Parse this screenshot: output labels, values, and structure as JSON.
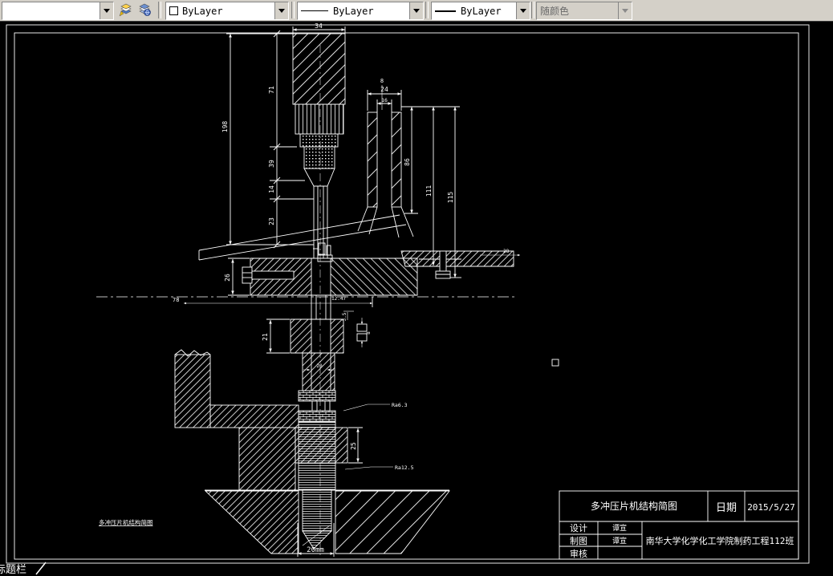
{
  "colors": {
    "toolbar_bg": "#d4d0c8",
    "canvas_bg": "#000000",
    "line": "#ffffff"
  },
  "toolbar": {
    "layer_combo_value": "",
    "color_value": "ByLayer",
    "linetype_value": "ByLayer",
    "lineweight_value": "ByLayer",
    "plotstyle_value": "随颜色"
  },
  "drawing": {
    "dims": {
      "d34": "34",
      "d71": "71",
      "d198": "198",
      "d39": "39",
      "d14": "14",
      "d23": "23",
      "d8top": "8",
      "d24": "24",
      "d16": "16",
      "d86": "86",
      "d111": "111",
      "d115": "115",
      "d26": "26",
      "d78": "78",
      "d28": "28",
      "d1247": "12.47",
      "d35": "3.5",
      "d8b": "8",
      "d21": "21",
      "d20": "20",
      "d25": "25",
      "d20mm": "20mm"
    },
    "leaders": {
      "l1": "Ra6.3",
      "l2": "Ra12.5"
    },
    "footnote": "多冲压片机结构简图"
  },
  "title_block": {
    "title": "多冲压片机结构简图",
    "date_label": "日期",
    "date_value": "2015/5/27",
    "design_label": "设计",
    "design_value": "谭宣",
    "draft_label": "制图",
    "draft_value": "谭宣",
    "review_label": "审核",
    "review_value": "",
    "org": "南华大学化学化工学院制药工程112班"
  },
  "status": {
    "partial_tab": "标题栏"
  }
}
